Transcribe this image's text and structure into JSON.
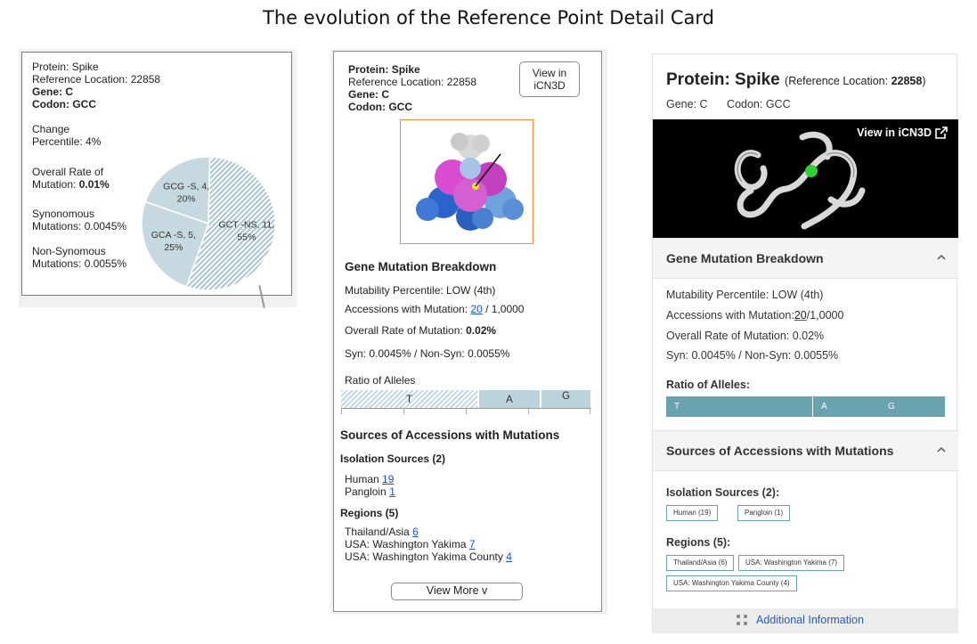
{
  "page": {
    "title": "The evolution of the Reference Point Detail Card"
  },
  "colors": {
    "pie_fill": "#c7d9e0",
    "allele_bar": "#6aa3b0",
    "image_border": "#f08a3a",
    "link": "#1a4fd8"
  },
  "card1": {
    "protein": "Protein: Spike",
    "ref_location": "Reference Location: 22858",
    "gene_label": "Gene: C",
    "codon_label": "Codon: GCC",
    "change_percentile_label": "Change",
    "change_percentile_value": "Percentile: 4%",
    "overall_rate_label": "Overall Rate of",
    "overall_rate_prefix": "Mutation:",
    "overall_rate_value": "0.01%",
    "syn_label": "Synonomous",
    "syn_value": "Mutations: 0.0045%",
    "nonsyn_label": "Non-Synomous",
    "nonsyn_value": "Mutations: 0.0055%",
    "pie": {
      "slices": [
        {
          "codon": "GCT",
          "type": "-NS",
          "count": 11,
          "percent": 55,
          "label_a": "GCT -NS, 11,",
          "label_b": "55%",
          "pattern": "hatched"
        },
        {
          "codon": "GCA",
          "type": "-S",
          "count": 5,
          "percent": 25,
          "label_a": "GCA -S, 5,",
          "label_b": "25%",
          "pattern": "solid"
        },
        {
          "codon": "GCG",
          "type": "-S",
          "count": 4,
          "percent": 20,
          "label_a": "GCG -S, 4,",
          "label_b": "20%",
          "pattern": "solid"
        }
      ]
    }
  },
  "card2": {
    "protein_label": "Protein:",
    "protein_value": "Spike",
    "ref_location": "Reference Location: 22858",
    "gene": "Gene: C",
    "codon": "Codon: GCC",
    "view_button_line1": "View in",
    "view_button_line2": "iCN3D",
    "mutation_breakdown_heading": "Gene Mutation Breakdown",
    "mutability": "Mutability Percentile: LOW   (4th)",
    "accessions_prefix": "Accessions with Mutation:",
    "accessions_link": "20",
    "accessions_suffix": "/ 1,0000",
    "overall_rate_label": "Overall Rate of Mutation:",
    "overall_rate_value": "0.02%",
    "syn_nonsyn": "Syn: 0.0045% / Non-Syn:  0.0055%",
    "ratio_label": "Ratio of Alleles",
    "alleles": [
      "T",
      "A",
      "G"
    ],
    "sources_heading": "Sources of Accessions with Mutations",
    "isolation_heading": "Isolation Sources (2)",
    "isolation_sources": [
      {
        "name": "Human",
        "count": "19"
      },
      {
        "name": "Pangloin",
        "count": "1"
      }
    ],
    "regions_heading": "Regions (5)",
    "regions": [
      {
        "name": "Thailand/Asia",
        "count": "6"
      },
      {
        "name": "USA: Washington Yakima",
        "count": "7"
      },
      {
        "name": "USA: Washington Yakima County",
        "count": "4"
      }
    ],
    "view_more": "View More v"
  },
  "card3": {
    "protein_title": "Protein: Spike",
    "ref_prefix": "(Reference Location:",
    "ref_value": "22858",
    "ref_suffix": ")",
    "gene": "Gene: C",
    "codon": "Codon: GCC",
    "view_link": "View in iCN3D",
    "mutation_breakdown_heading": "Gene Mutation Breakdown",
    "mutability": "Mutability Percentile: LOW (4th)",
    "accessions_prefix": "Accessions with Mutation:",
    "accessions_link": "20",
    "accessions_suffix": "/1,0000",
    "overall_rate": "Overall Rate of Mutation: 0.02%",
    "syn_nonsyn": "Syn: 0.0045% / Non-Syn: 0.0055%",
    "ratio_heading": "Ratio of Alleles:",
    "alleles": [
      "T",
      "A",
      "G"
    ],
    "sources_heading": "Sources of Accessions with Mutations",
    "isolation_heading": "Isolation Sources (2):",
    "isolation_chips": [
      "Human (19)",
      "Pangloin (1)"
    ],
    "regions_heading": "Regions (5):",
    "region_chips": [
      "Thailand/Asia (6)",
      "USA: Washington Yakima (7)",
      "USA: Washington Yakima County (4)"
    ],
    "additional_info": "Additional Information"
  }
}
